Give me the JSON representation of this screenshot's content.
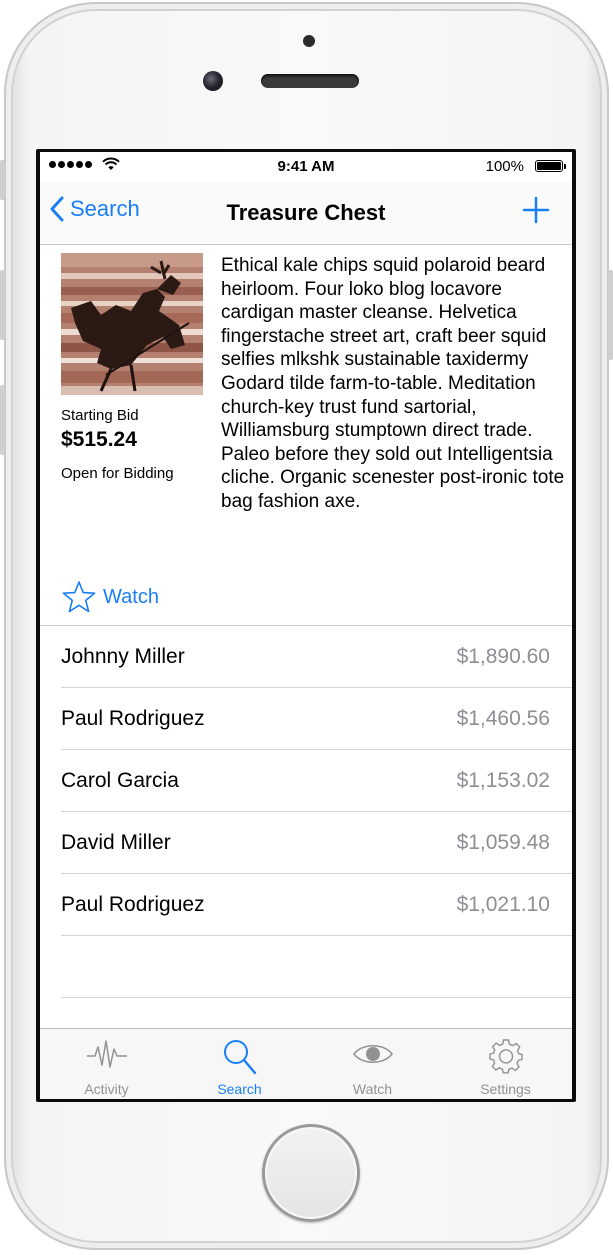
{
  "status_bar": {
    "time": "9:41 AM",
    "battery": "100%"
  },
  "nav": {
    "back_label": "Search",
    "title": "Treasure Chest",
    "add_icon": "plus-icon"
  },
  "item": {
    "image_icon": "item-photo",
    "starting_bid_label": "Starting Bid",
    "starting_bid": "$515.24",
    "status": "Open for Bidding",
    "description": "Ethical kale chips squid polaroid beard heirloom. Four loko blog locavore cardigan master cleanse. Helvetica fingerstache street art, craft beer squid selfies mlkshk sustainable taxidermy Godard tilde farm-to-table. Meditation church-key trust fund sartorial, Williamsburg stumptown direct trade. Paleo before they sold out Intelligentsia cliche. Organic scenester post-ironic tote bag fashion axe.",
    "watch_label": "Watch"
  },
  "bids": [
    {
      "name": "Johnny Miller",
      "amount": "$1,890.60"
    },
    {
      "name": "Paul Rodriguez",
      "amount": "$1,460.56"
    },
    {
      "name": "Carol Garcia",
      "amount": "$1,153.02"
    },
    {
      "name": "David Miller",
      "amount": "$1,059.48"
    },
    {
      "name": "Paul Rodriguez",
      "amount": "$1,021.10"
    }
  ],
  "tabs": [
    {
      "label": "Activity",
      "icon": "activity-icon",
      "active": false
    },
    {
      "label": "Search",
      "icon": "search-icon",
      "active": true
    },
    {
      "label": "Watch",
      "icon": "eye-icon",
      "active": false
    },
    {
      "label": "Settings",
      "icon": "gear-icon",
      "active": false
    }
  ],
  "colors": {
    "accent": "#1a7ef5",
    "inactive_tab": "#929292",
    "secondary_text": "#8e8e93"
  }
}
